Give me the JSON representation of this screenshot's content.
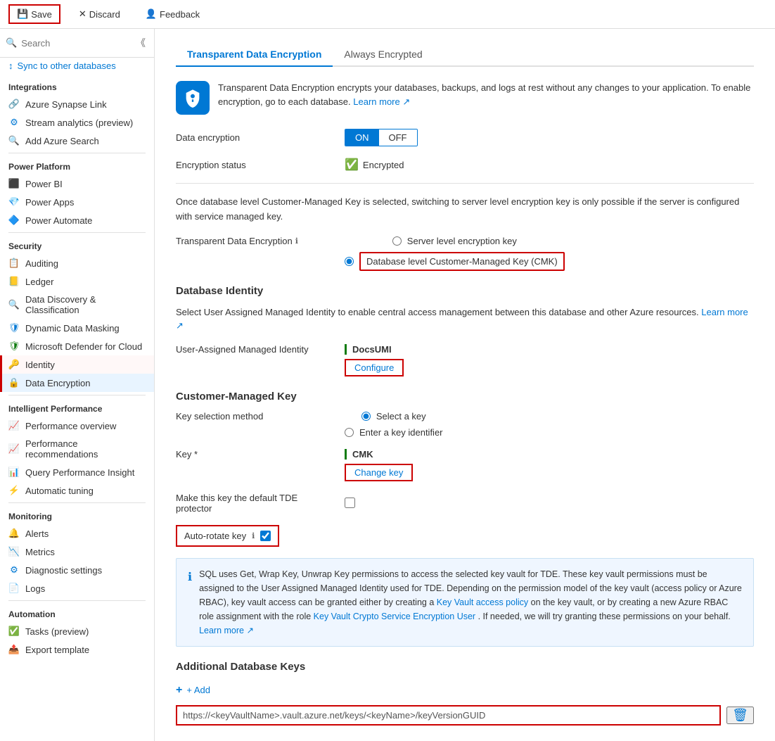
{
  "toolbar": {
    "save_label": "Save",
    "discard_label": "Discard",
    "feedback_label": "Feedback"
  },
  "sidebar": {
    "search_placeholder": "Search",
    "sync_label": "Sync to other databases",
    "sections": [
      {
        "label": "Integrations",
        "items": [
          {
            "id": "azure-synapse-link",
            "label": "Azure Synapse Link",
            "icon": "🔗"
          },
          {
            "id": "stream-analytics",
            "label": "Stream analytics (preview)",
            "icon": "📊"
          },
          {
            "id": "add-azure-search",
            "label": "Add Azure Search",
            "icon": "🔍"
          }
        ]
      },
      {
        "label": "Power Platform",
        "items": [
          {
            "id": "power-bi",
            "label": "Power BI",
            "icon": "📊"
          },
          {
            "id": "power-apps",
            "label": "Power Apps",
            "icon": "💎"
          },
          {
            "id": "power-automate",
            "label": "Power Automate",
            "icon": "🔷"
          }
        ]
      },
      {
        "label": "Security",
        "items": [
          {
            "id": "auditing",
            "label": "Auditing",
            "icon": "📋"
          },
          {
            "id": "ledger",
            "label": "Ledger",
            "icon": "📒"
          },
          {
            "id": "data-discovery",
            "label": "Data Discovery & Classification",
            "icon": "🔍"
          },
          {
            "id": "dynamic-data-masking",
            "label": "Dynamic Data Masking",
            "icon": "🛡"
          },
          {
            "id": "microsoft-defender",
            "label": "Microsoft Defender for Cloud",
            "icon": "🛡"
          },
          {
            "id": "identity",
            "label": "Identity",
            "icon": "🔑",
            "highlighted": true
          },
          {
            "id": "data-encryption",
            "label": "Data Encryption",
            "icon": "🔒",
            "active": true
          }
        ]
      },
      {
        "label": "Intelligent Performance",
        "items": [
          {
            "id": "performance-overview",
            "label": "Performance overview",
            "icon": "📈"
          },
          {
            "id": "performance-recommendations",
            "label": "Performance recommendations",
            "icon": "📈"
          },
          {
            "id": "query-performance-insight",
            "label": "Query Performance Insight",
            "icon": "📊"
          },
          {
            "id": "automatic-tuning",
            "label": "Automatic tuning",
            "icon": "⚡"
          }
        ]
      },
      {
        "label": "Monitoring",
        "items": [
          {
            "id": "alerts",
            "label": "Alerts",
            "icon": "🔔"
          },
          {
            "id": "metrics",
            "label": "Metrics",
            "icon": "📉"
          },
          {
            "id": "diagnostic-settings",
            "label": "Diagnostic settings",
            "icon": "⚙"
          },
          {
            "id": "logs",
            "label": "Logs",
            "icon": "📄"
          }
        ]
      },
      {
        "label": "Automation",
        "items": [
          {
            "id": "tasks-preview",
            "label": "Tasks (preview)",
            "icon": "✅"
          },
          {
            "id": "export-template",
            "label": "Export template",
            "icon": "📤"
          }
        ]
      }
    ]
  },
  "content": {
    "tabs": [
      {
        "id": "transparent-data-encryption",
        "label": "Transparent Data Encryption",
        "active": true
      },
      {
        "id": "always-encrypted",
        "label": "Always Encrypted",
        "active": false
      }
    ],
    "banner_text": "Transparent Data Encryption encrypts your databases, backups, and logs at rest without any changes to your application. To enable encryption, go to each database.",
    "banner_learn_more": "Learn more",
    "data_encryption_label": "Data encryption",
    "toggle_on": "ON",
    "toggle_off": "OFF",
    "encryption_status_label": "Encryption status",
    "encryption_status_value": "Encrypted",
    "cmk_info_text": "Once database level Customer-Managed Key is selected, switching to server level encryption key is only possible if the server is configured with service managed key.",
    "tde_label": "Transparent Data Encryption",
    "radio_server_level": "Server level encryption key",
    "radio_database_level": "Database level Customer-Managed Key (CMK)",
    "database_identity_header": "Database Identity",
    "database_identity_info": "Select User Assigned Managed Identity to enable central access management between this database and other Azure resources.",
    "learn_more_label": "Learn more",
    "user_assigned_managed_identity_label": "User-Assigned Managed Identity",
    "identity_value": "DocsUMI",
    "configure_label": "Configure",
    "customer_managed_key_header": "Customer-Managed Key",
    "key_selection_method_label": "Key selection method",
    "radio_select_key": "Select a key",
    "radio_enter_key_identifier": "Enter a key identifier",
    "key_label": "Key *",
    "key_value": "CMK",
    "change_key_label": "Change key",
    "make_default_tde_label": "Make this key the default TDE protector",
    "auto_rotate_label": "Auto-rotate key",
    "sql_info_text": "SQL uses Get, Wrap Key, Unwrap Key permissions to access the selected key vault for TDE. These key vault permissions must be assigned to the User Assigned Managed Identity used for TDE. Depending on the permission model of the key vault (access policy or Azure RBAC), key vault access can be granted either by creating a",
    "key_vault_access_policy": "Key Vault access policy",
    "sql_info_text2": "on the key vault, or by creating a new Azure RBAC role assignment with the role",
    "key_vault_crypto": "Key Vault Crypto Service Encryption User",
    "sql_info_text3": ". If needed, we will try granting these permissions on your behalf.",
    "learn_more2": "Learn more",
    "additional_database_keys_header": "Additional Database Keys",
    "add_label": "+ Add",
    "url_placeholder": "https://<keyVaultName>.vault.azure.net/keys/<keyName>/keyVersionGUID"
  }
}
